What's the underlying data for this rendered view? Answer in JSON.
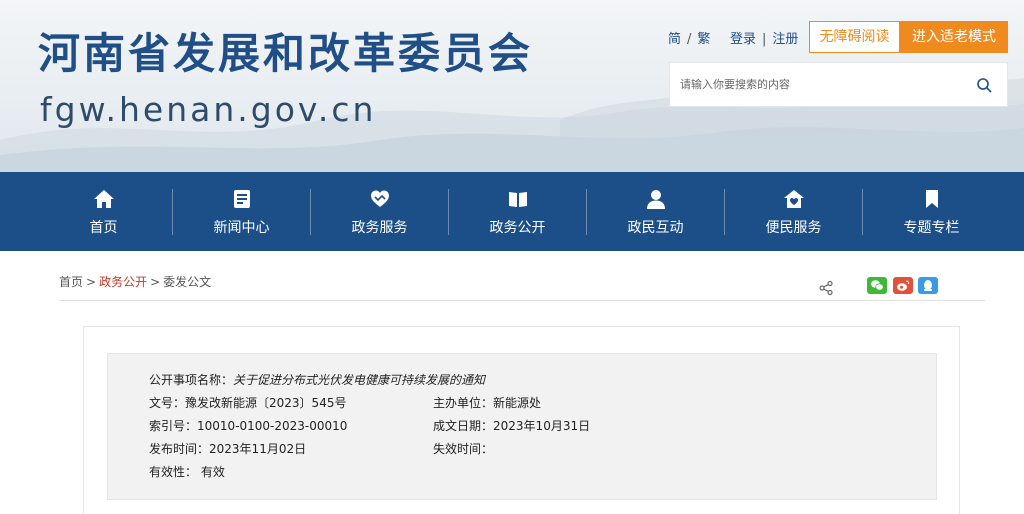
{
  "header": {
    "site_title": "河南省发展和改革委员会",
    "site_domain": "fgw.henan.gov.cn",
    "lang_simplified": "简",
    "lang_separator": "/",
    "lang_traditional": "繁",
    "login": "登录",
    "auth_separator": "|",
    "register": "注册",
    "accessible_reading": "无障碍阅读",
    "elder_mode": "进入适老模式",
    "search_placeholder": "请输入你要搜索的内容"
  },
  "nav": {
    "items": [
      {
        "label": "首页",
        "icon": "home-icon"
      },
      {
        "label": "新闻中心",
        "icon": "news-icon"
      },
      {
        "label": "政务服务",
        "icon": "handshake-heart-icon"
      },
      {
        "label": "政务公开",
        "icon": "open-book-icon"
      },
      {
        "label": "政民互动",
        "icon": "user-icon"
      },
      {
        "label": "便民服务",
        "icon": "house-heart-icon"
      },
      {
        "label": "专题专栏",
        "icon": "bookmark-icon"
      }
    ]
  },
  "breadcrumb": {
    "home": "首页",
    "arrow": ">",
    "section": "政务公开",
    "current": "委发公文"
  },
  "share": {
    "icons": [
      "share-icon",
      "wechat-icon",
      "weibo-icon",
      "qq-icon"
    ],
    "colors": {
      "wechat": "#3fb838",
      "weibo": "#e2523a",
      "qq": "#3a9be5"
    }
  },
  "document_meta": {
    "title_label": "公开事项名称：",
    "title_value": "关于促进分布式光伏发电健康可持续发展的通知",
    "doc_number_label": "文号：",
    "doc_number_value": "豫发改新能源〔2023〕545号",
    "host_unit_label": "主办单位：",
    "host_unit_value": "新能源处",
    "index_label": "索引号：",
    "index_value": "10010-0100-2023-00010",
    "written_date_label": "成文日期：",
    "written_date_value": "2023年10月31日",
    "publish_date_label": "发布时间：",
    "publish_date_value": "2023年11月02日",
    "expire_label": "失效时间：",
    "expire_value": "",
    "validity_label": "有效性：",
    "validity_value": "有效"
  },
  "colors": {
    "brand_blue": "#1c4f88",
    "accent_orange": "#ef8a1f",
    "breadcrumb_active": "#c0392b"
  }
}
